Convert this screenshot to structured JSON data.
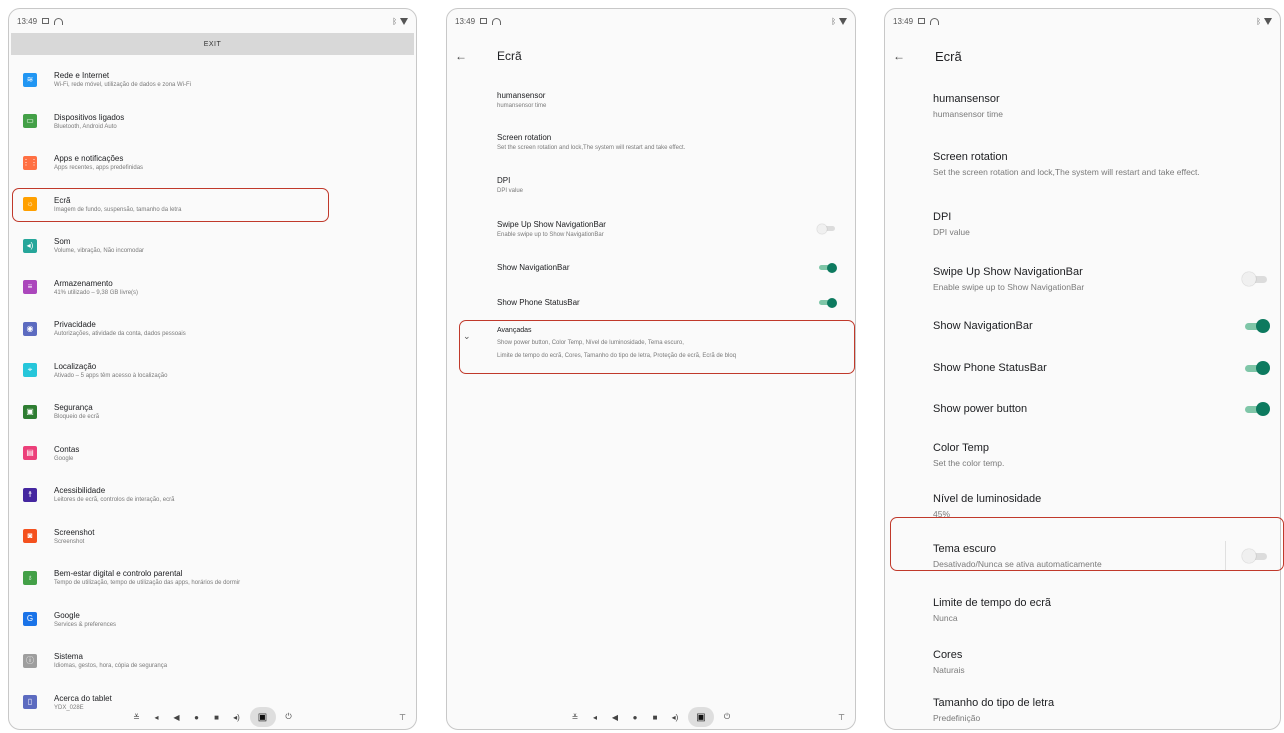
{
  "status_time": "13:49",
  "panel1": {
    "exit_label": "EXIT",
    "items": [
      {
        "title": "Rede e Internet",
        "subtitle": "Wi-Fi, rede móvel, utilização de dados e zona Wi-Fi",
        "icon": "wifi-icon",
        "color": "#2196f3",
        "glyph": "≋"
      },
      {
        "title": "Dispositivos ligados",
        "subtitle": "Bluetooth, Android Auto",
        "icon": "devices-icon",
        "color": "#43a047",
        "glyph": "▭"
      },
      {
        "title": "Apps e notificações",
        "subtitle": "Apps recentes, apps predefinidas",
        "icon": "apps-icon",
        "color": "#ff7043",
        "glyph": "⋮⋮"
      },
      {
        "title": "Ecrã",
        "subtitle": "Imagem de fundo, suspensão, tamanho da letra",
        "icon": "brightness-icon",
        "color": "#ffa000",
        "glyph": "☼"
      },
      {
        "title": "Som",
        "subtitle": "Volume, vibração, Não incomodar",
        "icon": "volume-icon",
        "color": "#26a69a",
        "glyph": "◂)"
      },
      {
        "title": "Armazenamento",
        "subtitle": "41% utilizado – 9,38 GB livre(s)",
        "icon": "storage-icon",
        "color": "#ab47bc",
        "glyph": "≡"
      },
      {
        "title": "Privacidade",
        "subtitle": "Autorizações, atividade da conta, dados pessoais",
        "icon": "privacy-icon",
        "color": "#5c6bc0",
        "glyph": "◉"
      },
      {
        "title": "Localização",
        "subtitle": "Ativado – 5 apps têm acesso à localização",
        "icon": "location-icon",
        "color": "#26c6da",
        "glyph": "⌖"
      },
      {
        "title": "Segurança",
        "subtitle": "Bloqueio de ecrã",
        "icon": "lock-icon",
        "color": "#2e7d32",
        "glyph": "▣"
      },
      {
        "title": "Contas",
        "subtitle": "Google",
        "icon": "accounts-icon",
        "color": "#ec407a",
        "glyph": "▤"
      },
      {
        "title": "Acessibilidade",
        "subtitle": "Leitores de ecrã, controlos de interação, ecrã",
        "icon": "accessibility-icon",
        "color": "#4527a0",
        "glyph": "☨"
      },
      {
        "title": "Screenshot",
        "subtitle": "Screenshot",
        "icon": "camera-icon",
        "color": "#f4511e",
        "glyph": "◙"
      },
      {
        "title": "Bem-estar digital e controlo parental",
        "subtitle": "Tempo de utilização, tempo de utilização das apps, horários de dormir",
        "icon": "wellbeing-icon",
        "color": "#43a047",
        "glyph": "♁"
      },
      {
        "title": "Google",
        "subtitle": "Services & preferences",
        "icon": "google-icon",
        "color": "#1a73e8",
        "glyph": "G"
      },
      {
        "title": "Sistema",
        "subtitle": "Idiomas, gestos, hora, cópia de segurança",
        "icon": "system-icon",
        "color": "#9e9e9e",
        "glyph": "ⓘ"
      },
      {
        "title": "Acerca do tablet",
        "subtitle": "YDX_028E",
        "icon": "tablet-icon",
        "color": "#5c6bc0",
        "glyph": "▯"
      }
    ]
  },
  "panel2": {
    "title": "Ecrã",
    "items": [
      {
        "title": "humansensor",
        "subtitle": "humansensor time",
        "toggle": ""
      },
      {
        "title": "Screen rotation",
        "subtitle": "Set the screen rotation and lock,The system will restart and take effect.",
        "toggle": ""
      },
      {
        "title": "DPI",
        "subtitle": "DPI value",
        "toggle": ""
      },
      {
        "title": "Swipe Up Show NavigationBar",
        "subtitle": "Enable swipe up to Show NavigationBar",
        "toggle": "off"
      },
      {
        "title": "Show NavigationBar",
        "subtitle": "",
        "toggle": "on"
      },
      {
        "title": "Show Phone StatusBar",
        "subtitle": "",
        "toggle": "on"
      }
    ],
    "advanced": {
      "title": "Avançadas",
      "summary_line1": "Show power button, Color Temp, Nível de luminosidade, Tema escuro,",
      "summary_line2": "Limite de tempo do ecrã, Cores, Tamanho do tipo de letra, Proteção de ecrã, Ecrã de bloq"
    }
  },
  "panel3": {
    "title": "Ecrã",
    "items": [
      {
        "title": "humansensor",
        "subtitle": "humansensor time",
        "toggle": ""
      },
      {
        "title": "Screen rotation",
        "subtitle": "Set the screen rotation and lock,The system will restart and take effect.",
        "toggle": ""
      },
      {
        "title": "DPI",
        "subtitle": "DPI value",
        "toggle": ""
      },
      {
        "title": "Swipe Up Show NavigationBar",
        "subtitle": "Enable swipe up to Show NavigationBar",
        "toggle": "off"
      },
      {
        "title": "Show NavigationBar",
        "subtitle": "",
        "toggle": "on"
      },
      {
        "title": "Show Phone StatusBar",
        "subtitle": "",
        "toggle": "on"
      },
      {
        "title": "Show power button",
        "subtitle": "",
        "toggle": "on"
      },
      {
        "title": "Color Temp",
        "subtitle": "Set the color temp.",
        "toggle": ""
      },
      {
        "title": "Nível de luminosidade",
        "subtitle": "45%",
        "toggle": ""
      },
      {
        "title": "Tema escuro",
        "subtitle": "Desativado/Nunca se ativa automaticamente",
        "toggle": "off"
      },
      {
        "title": "Limite de tempo do ecrã",
        "subtitle": "Nunca",
        "toggle": ""
      },
      {
        "title": "Cores",
        "subtitle": "Naturais",
        "toggle": ""
      },
      {
        "title": "Tamanho do tipo de letra",
        "subtitle": "Predefinição",
        "toggle": ""
      }
    ]
  },
  "colors": {
    "accent": "#0d7a5f",
    "highlight": "#c0392b"
  }
}
